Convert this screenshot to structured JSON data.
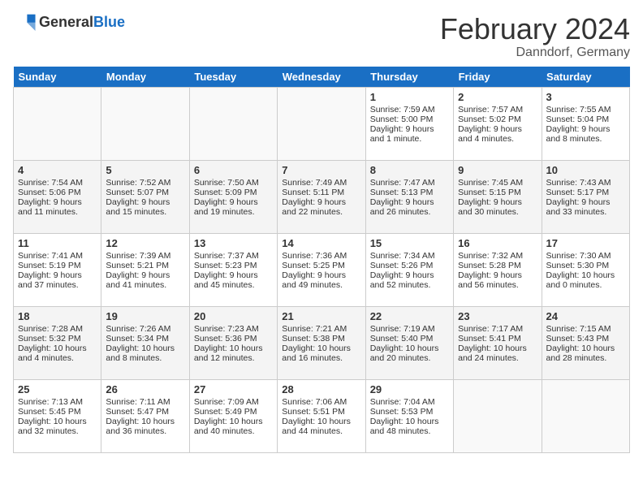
{
  "logo": {
    "text_general": "General",
    "text_blue": "Blue"
  },
  "title": "February 2024",
  "subtitle": "Danndorf, Germany",
  "days_of_week": [
    "Sunday",
    "Monday",
    "Tuesday",
    "Wednesday",
    "Thursday",
    "Friday",
    "Saturday"
  ],
  "weeks": [
    [
      {
        "day": "",
        "sunrise": "",
        "sunset": "",
        "daylight": ""
      },
      {
        "day": "",
        "sunrise": "",
        "sunset": "",
        "daylight": ""
      },
      {
        "day": "",
        "sunrise": "",
        "sunset": "",
        "daylight": ""
      },
      {
        "day": "",
        "sunrise": "",
        "sunset": "",
        "daylight": ""
      },
      {
        "day": "1",
        "sunrise": "Sunrise: 7:59 AM",
        "sunset": "Sunset: 5:00 PM",
        "daylight": "Daylight: 9 hours and 1 minute."
      },
      {
        "day": "2",
        "sunrise": "Sunrise: 7:57 AM",
        "sunset": "Sunset: 5:02 PM",
        "daylight": "Daylight: 9 hours and 4 minutes."
      },
      {
        "day": "3",
        "sunrise": "Sunrise: 7:55 AM",
        "sunset": "Sunset: 5:04 PM",
        "daylight": "Daylight: 9 hours and 8 minutes."
      }
    ],
    [
      {
        "day": "4",
        "sunrise": "Sunrise: 7:54 AM",
        "sunset": "Sunset: 5:06 PM",
        "daylight": "Daylight: 9 hours and 11 minutes."
      },
      {
        "day": "5",
        "sunrise": "Sunrise: 7:52 AM",
        "sunset": "Sunset: 5:07 PM",
        "daylight": "Daylight: 9 hours and 15 minutes."
      },
      {
        "day": "6",
        "sunrise": "Sunrise: 7:50 AM",
        "sunset": "Sunset: 5:09 PM",
        "daylight": "Daylight: 9 hours and 19 minutes."
      },
      {
        "day": "7",
        "sunrise": "Sunrise: 7:49 AM",
        "sunset": "Sunset: 5:11 PM",
        "daylight": "Daylight: 9 hours and 22 minutes."
      },
      {
        "day": "8",
        "sunrise": "Sunrise: 7:47 AM",
        "sunset": "Sunset: 5:13 PM",
        "daylight": "Daylight: 9 hours and 26 minutes."
      },
      {
        "day": "9",
        "sunrise": "Sunrise: 7:45 AM",
        "sunset": "Sunset: 5:15 PM",
        "daylight": "Daylight: 9 hours and 30 minutes."
      },
      {
        "day": "10",
        "sunrise": "Sunrise: 7:43 AM",
        "sunset": "Sunset: 5:17 PM",
        "daylight": "Daylight: 9 hours and 33 minutes."
      }
    ],
    [
      {
        "day": "11",
        "sunrise": "Sunrise: 7:41 AM",
        "sunset": "Sunset: 5:19 PM",
        "daylight": "Daylight: 9 hours and 37 minutes."
      },
      {
        "day": "12",
        "sunrise": "Sunrise: 7:39 AM",
        "sunset": "Sunset: 5:21 PM",
        "daylight": "Daylight: 9 hours and 41 minutes."
      },
      {
        "day": "13",
        "sunrise": "Sunrise: 7:37 AM",
        "sunset": "Sunset: 5:23 PM",
        "daylight": "Daylight: 9 hours and 45 minutes."
      },
      {
        "day": "14",
        "sunrise": "Sunrise: 7:36 AM",
        "sunset": "Sunset: 5:25 PM",
        "daylight": "Daylight: 9 hours and 49 minutes."
      },
      {
        "day": "15",
        "sunrise": "Sunrise: 7:34 AM",
        "sunset": "Sunset: 5:26 PM",
        "daylight": "Daylight: 9 hours and 52 minutes."
      },
      {
        "day": "16",
        "sunrise": "Sunrise: 7:32 AM",
        "sunset": "Sunset: 5:28 PM",
        "daylight": "Daylight: 9 hours and 56 minutes."
      },
      {
        "day": "17",
        "sunrise": "Sunrise: 7:30 AM",
        "sunset": "Sunset: 5:30 PM",
        "daylight": "Daylight: 10 hours and 0 minutes."
      }
    ],
    [
      {
        "day": "18",
        "sunrise": "Sunrise: 7:28 AM",
        "sunset": "Sunset: 5:32 PM",
        "daylight": "Daylight: 10 hours and 4 minutes."
      },
      {
        "day": "19",
        "sunrise": "Sunrise: 7:26 AM",
        "sunset": "Sunset: 5:34 PM",
        "daylight": "Daylight: 10 hours and 8 minutes."
      },
      {
        "day": "20",
        "sunrise": "Sunrise: 7:23 AM",
        "sunset": "Sunset: 5:36 PM",
        "daylight": "Daylight: 10 hours and 12 minutes."
      },
      {
        "day": "21",
        "sunrise": "Sunrise: 7:21 AM",
        "sunset": "Sunset: 5:38 PM",
        "daylight": "Daylight: 10 hours and 16 minutes."
      },
      {
        "day": "22",
        "sunrise": "Sunrise: 7:19 AM",
        "sunset": "Sunset: 5:40 PM",
        "daylight": "Daylight: 10 hours and 20 minutes."
      },
      {
        "day": "23",
        "sunrise": "Sunrise: 7:17 AM",
        "sunset": "Sunset: 5:41 PM",
        "daylight": "Daylight: 10 hours and 24 minutes."
      },
      {
        "day": "24",
        "sunrise": "Sunrise: 7:15 AM",
        "sunset": "Sunset: 5:43 PM",
        "daylight": "Daylight: 10 hours and 28 minutes."
      }
    ],
    [
      {
        "day": "25",
        "sunrise": "Sunrise: 7:13 AM",
        "sunset": "Sunset: 5:45 PM",
        "daylight": "Daylight: 10 hours and 32 minutes."
      },
      {
        "day": "26",
        "sunrise": "Sunrise: 7:11 AM",
        "sunset": "Sunset: 5:47 PM",
        "daylight": "Daylight: 10 hours and 36 minutes."
      },
      {
        "day": "27",
        "sunrise": "Sunrise: 7:09 AM",
        "sunset": "Sunset: 5:49 PM",
        "daylight": "Daylight: 10 hours and 40 minutes."
      },
      {
        "day": "28",
        "sunrise": "Sunrise: 7:06 AM",
        "sunset": "Sunset: 5:51 PM",
        "daylight": "Daylight: 10 hours and 44 minutes."
      },
      {
        "day": "29",
        "sunrise": "Sunrise: 7:04 AM",
        "sunset": "Sunset: 5:53 PM",
        "daylight": "Daylight: 10 hours and 48 minutes."
      },
      {
        "day": "",
        "sunrise": "",
        "sunset": "",
        "daylight": ""
      },
      {
        "day": "",
        "sunrise": "",
        "sunset": "",
        "daylight": ""
      }
    ]
  ]
}
